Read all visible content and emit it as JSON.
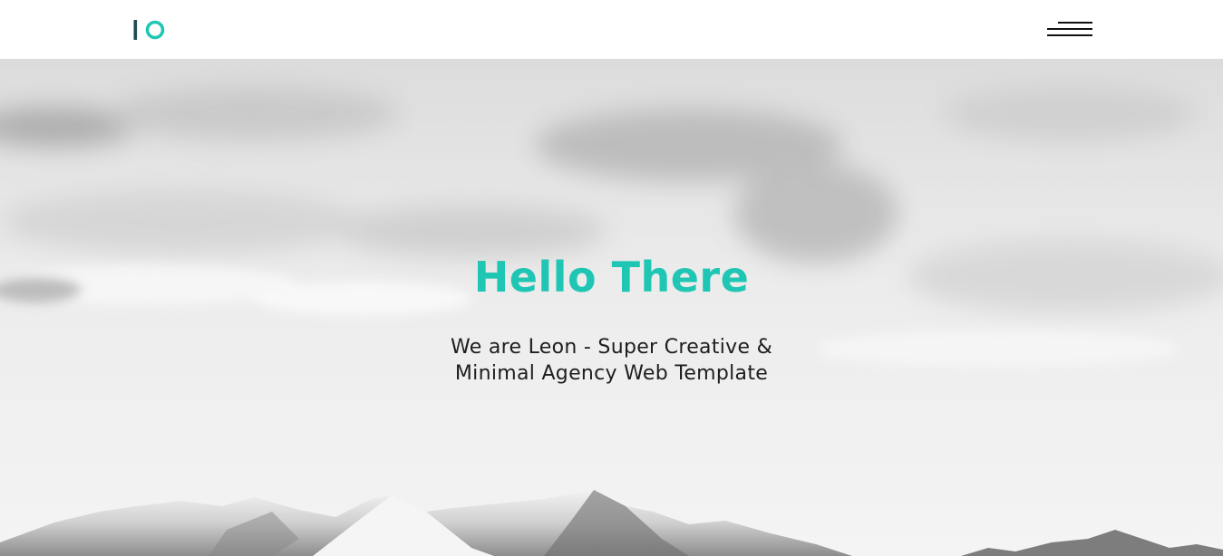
{
  "brand": {
    "name": "Leon",
    "accent_color": "#1fc6b4",
    "dark_color": "#1e4b55"
  },
  "header": {
    "logo_icon": "io-logo-icon",
    "menu_icon": "hamburger-menu-icon"
  },
  "hero": {
    "title": "Hello There",
    "subtitle": "We are Leon - Super Creative & Minimal Agency Web Template",
    "background": "black-and-white cloudy sky over snowy mountains"
  }
}
